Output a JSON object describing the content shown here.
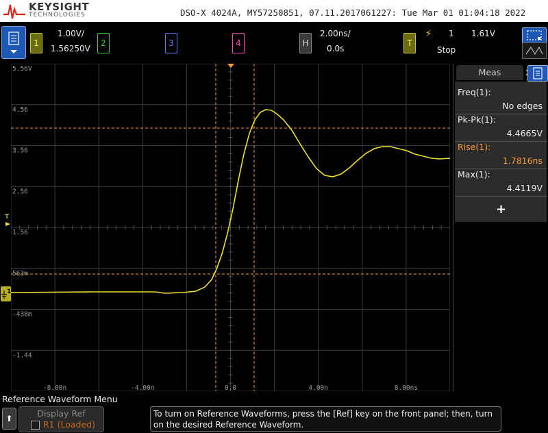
{
  "header": {
    "brand": "KEYSIGHT",
    "brand_sub": "TECHNOLOGIES",
    "instrument_info": "DSO-X 4024A, MY57250851, 07.11.2017061227: Tue Mar 01 01:04:18 2022"
  },
  "controls": {
    "ch1_number": "1",
    "ch1_scale": "1.00V/",
    "ch1_offset": "1.56250V",
    "ch2_number": "2",
    "ch3_number": "3",
    "ch4_number": "4",
    "horizontal_label": "H",
    "time_per_div": "2.00ns/",
    "time_delay": "0.0s",
    "trigger_label": "T",
    "trigger_source": "1",
    "trigger_level": "1.61V",
    "run_status": "Stop"
  },
  "graticule": {
    "y_labels": [
      "5.56V",
      "4.56",
      "3.56",
      "2.56",
      "1.56",
      "563m",
      "-438m",
      "-1.44"
    ],
    "x_labels": [
      "-8.00n",
      "-4.00n",
      "0.0",
      "4.00n",
      "8.00ns"
    ],
    "trigger_marker": "T",
    "ground_marker": "1"
  },
  "measurements": {
    "tab_label": "Meas",
    "items": [
      {
        "label": "Freq(1):",
        "value": "No edges",
        "highlight": false
      },
      {
        "label": "Pk-Pk(1):",
        "value": "4.4665V",
        "highlight": false
      },
      {
        "label": "Rise(1):",
        "value": "1.7816ns",
        "highlight": true
      },
      {
        "label": "Max(1):",
        "value": "4.4119V",
        "highlight": false
      }
    ],
    "add_label": "+"
  },
  "footer": {
    "menu_title": "Reference Waveform Menu",
    "softkey_label": "Display Ref",
    "softkey_value": "R1 (Loaded)",
    "message": "To turn on Reference Waveforms, press the [Ref] key on the front panel; then, turn on the desired Reference Waveform."
  },
  "colors": {
    "ch1": "#f0e030",
    "ch2": "#34d634",
    "ch3": "#5a7aff",
    "ch4": "#ff4cb2",
    "cursor": "#ff9b3a",
    "accent": "#1e58b6"
  }
}
